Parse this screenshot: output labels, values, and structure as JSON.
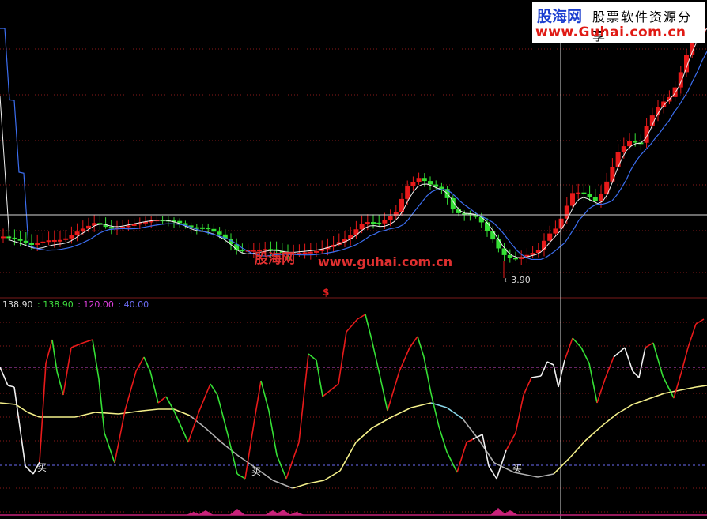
{
  "watermark": {
    "site_name_cn": "股海网",
    "tagline_cn": "股票软件资源分享",
    "url_top": "www.Guhai.com.cn",
    "center_cn": "股海网",
    "center_url": "www.guhai.com.cn"
  },
  "main_panel": {
    "low_label": "←3.90",
    "s_marker": "$"
  },
  "indicator": {
    "legend": [
      {
        "text": "138.90",
        "color": "#d8d8d8"
      },
      {
        "text": ": 138.90",
        "color": "#3fe03f"
      },
      {
        "text": ": 120.00",
        "color": "#e040e0"
      },
      {
        "text": ": 40.00",
        "color": "#6d6df5"
      }
    ],
    "buy_label": "买",
    "levels": [
      120.0,
      40.0
    ]
  },
  "colors": {
    "up_candle": "#e81a1a",
    "down_candle": "#35e035",
    "ma_white": "#f0f0f0",
    "ma_blue": "#3c6ef0",
    "osc_up": "#e81a1a",
    "osc_down": "#35e035",
    "signal_yellow": "#f4f08a",
    "grid": "#8a1a1a",
    "level_line": "#c84ac8",
    "crosshair": "#d8d8d8"
  }
}
